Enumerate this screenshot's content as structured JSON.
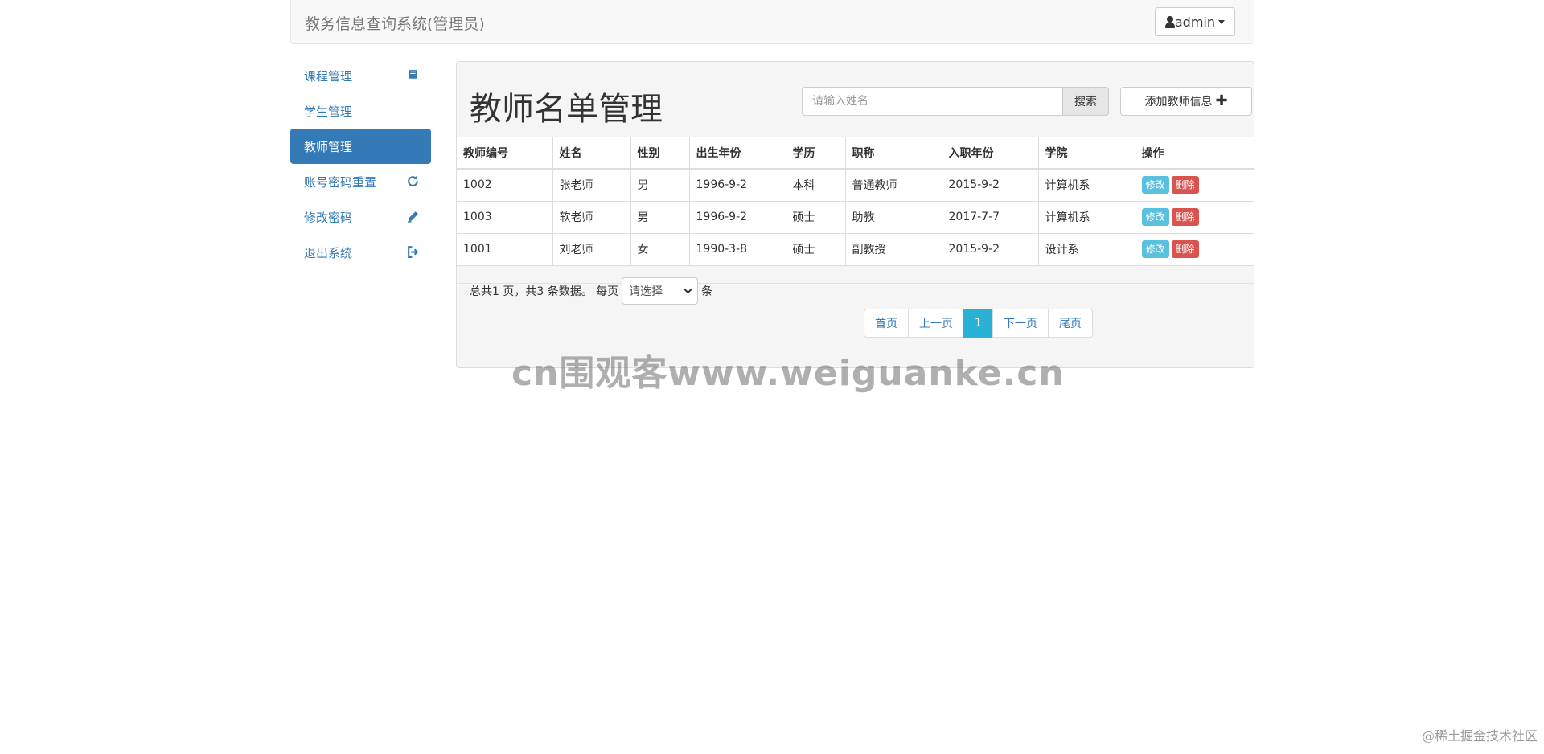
{
  "navbar": {
    "brand": "教务信息查询系统(管理员)",
    "user": "admin"
  },
  "sidebar": {
    "items": [
      {
        "label": "课程管理",
        "icon": "book-icon",
        "active": false
      },
      {
        "label": "学生管理",
        "icon": "",
        "active": false
      },
      {
        "label": "教师管理",
        "icon": "",
        "active": true
      },
      {
        "label": "账号密码重置",
        "icon": "refresh-icon",
        "active": false
      },
      {
        "label": "修改密码",
        "icon": "pencil-icon",
        "active": false
      },
      {
        "label": "退出系统",
        "icon": "logout-icon",
        "active": false
      }
    ]
  },
  "main": {
    "title": "教师名单管理",
    "search": {
      "placeholder": "请输入姓名",
      "value": "",
      "button": "搜索"
    },
    "add_button": "添加教师信息",
    "table": {
      "headers": [
        "教师编号",
        "姓名",
        "性别",
        "出生年份",
        "学历",
        "职称",
        "入职年份",
        "学院",
        "操作"
      ],
      "rows": [
        [
          "1002",
          "张老师",
          "男",
          "1996-9-2",
          "本科",
          "普通教师",
          "2015-9-2",
          "计算机系"
        ],
        [
          "1003",
          "软老师",
          "男",
          "1996-9-2",
          "硕士",
          "助教",
          "2017-7-7",
          "计算机系"
        ],
        [
          "1001",
          "刘老师",
          "女",
          "1990-3-8",
          "硕士",
          "副教授",
          "2015-9-2",
          "设计系"
        ]
      ],
      "edit_label": "修改",
      "delete_label": "删除"
    },
    "pager_info": {
      "prefix": "总共1 页，共3 条数据。 每页",
      "select_value": "请选择",
      "suffix": "条"
    },
    "pagination": [
      "首页",
      "上一页",
      "1",
      "下一页",
      "尾页"
    ],
    "current_page": "1"
  },
  "watermark": "cn围观客www.weiguanke.cn",
  "corner_mark": "@稀土掘金技术社区",
  "colors": {
    "primary": "#337ab7",
    "info": "#5bc0de",
    "danger": "#d9534f",
    "active_page": "#2ab1d6"
  }
}
